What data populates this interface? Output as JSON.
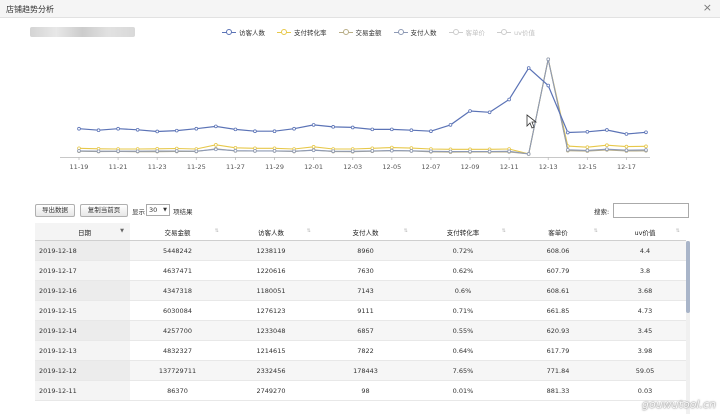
{
  "window": {
    "title": "店铺趋势分析",
    "close_glyph": "×"
  },
  "legend": [
    {
      "name": "访客人数",
      "color": "#5b73b6",
      "active": true
    },
    {
      "name": "支付转化率",
      "color": "#e7c84a",
      "active": true
    },
    {
      "name": "交易金额",
      "color": "#b8ad86",
      "active": true
    },
    {
      "name": "支付人数",
      "color": "#8e9ab5",
      "active": true
    },
    {
      "name": "客单价",
      "color": "#cccccc",
      "active": false
    },
    {
      "name": "uv价值",
      "color": "#cccccc",
      "active": false
    }
  ],
  "chart_data": {
    "type": "line",
    "x_tick_labels": [
      "11-19",
      "11-21",
      "11-23",
      "11-25",
      "11-27",
      "11-29",
      "12-01",
      "12-03",
      "12-05",
      "12-07",
      "12-09",
      "12-11",
      "12-13",
      "12-15",
      "12-17"
    ],
    "x": [
      "11-19",
      "11-20",
      "11-21",
      "11-22",
      "11-23",
      "11-24",
      "11-25",
      "11-26",
      "11-27",
      "11-28",
      "11-29",
      "11-30",
      "12-01",
      "12-02",
      "12-03",
      "12-04",
      "12-05",
      "12-06",
      "12-07",
      "12-08",
      "12-09",
      "12-10",
      "12-11",
      "12-12",
      "12-13",
      "12-14",
      "12-15",
      "12-16",
      "12-17",
      "12-18"
    ],
    "series": [
      {
        "name": "访客人数",
        "color": "#5b73b6",
        "values": [
          1306000,
          1270000,
          1306000,
          1280000,
          1240000,
          1260000,
          1306000,
          1360000,
          1290000,
          1246000,
          1246000,
          1306000,
          1396000,
          1350000,
          1336000,
          1290000,
          1290000,
          1270000,
          1246000,
          1396000,
          1726000,
          1696000,
          2000000,
          2749270,
          2332456,
          1214615,
          1233048,
          1276123,
          1180051,
          1220616,
          1238119
        ]
      },
      {
        "name": "支付转化率",
        "color": "#e7c84a",
        "values": [
          0.46,
          0.42,
          0.4,
          0.4,
          0.42,
          0.44,
          0.4,
          0.74,
          0.5,
          0.46,
          0.46,
          0.4,
          0.58,
          0.4,
          0.4,
          0.46,
          0.52,
          0.48,
          0.4,
          0.38,
          0.38,
          0.38,
          0.4,
          0.01,
          7.65,
          0.64,
          0.55,
          0.71,
          0.6,
          0.62,
          0.72
        ]
      },
      {
        "name": "交易金额",
        "color": "#b8ad86",
        "values": [
          4000000,
          3500000,
          3600000,
          3400000,
          3400000,
          3700000,
          3600000,
          7600000,
          4500000,
          4300000,
          4300000,
          3600000,
          6000000,
          3500000,
          3300000,
          4000000,
          5000000,
          4300000,
          3200000,
          2800000,
          2900000,
          2900000,
          3000000,
          86370,
          137729711,
          4832327,
          4257700,
          6030084,
          4347318,
          4637471,
          5448242
        ]
      },
      {
        "name": "支付人数",
        "color": "#8e9ab5",
        "values": [
          5800,
          5200,
          5300,
          5200,
          5400,
          5600,
          5200,
          8800,
          6200,
          5800,
          5800,
          5200,
          7000,
          5300,
          5100,
          5800,
          6400,
          6000,
          5000,
          4700,
          4700,
          4800,
          5000,
          98,
          178443,
          7822,
          6857,
          9111,
          7143,
          7630,
          8960
        ]
      }
    ],
    "legend_position": "top-center",
    "grid": false
  },
  "toolbar": {
    "export_label": "导出数据",
    "copy_label": "复制当前页",
    "show_label": "显示",
    "page_size": "30",
    "rows_label": "项结果",
    "search_label": "搜索:",
    "search_value": ""
  },
  "table": {
    "columns": [
      "日期",
      "交易金额",
      "访客人数",
      "支付人数",
      "支付转化率",
      "客单价",
      "uv价值"
    ],
    "rows": [
      [
        "2019-12-18",
        "5448242",
        "1238119",
        "8960",
        "0.72%",
        "608.06",
        "4.4"
      ],
      [
        "2019-12-17",
        "4637471",
        "1220616",
        "7630",
        "0.62%",
        "607.79",
        "3.8"
      ],
      [
        "2019-12-16",
        "4347318",
        "1180051",
        "7143",
        "0.6%",
        "608.61",
        "3.68"
      ],
      [
        "2019-12-15",
        "6030084",
        "1276123",
        "9111",
        "0.71%",
        "661.85",
        "4.73"
      ],
      [
        "2019-12-14",
        "4257700",
        "1233048",
        "6857",
        "0.55%",
        "620.93",
        "3.45"
      ],
      [
        "2019-12-13",
        "4832327",
        "1214615",
        "7822",
        "0.64%",
        "617.79",
        "3.98"
      ],
      [
        "2019-12-12",
        "137729711",
        "2332456",
        "178443",
        "7.65%",
        "771.84",
        "59.05"
      ],
      [
        "2019-12-11",
        "86370",
        "2749270",
        "98",
        "0.01%",
        "881.33",
        "0.03"
      ]
    ]
  },
  "watermark": "gouwutool.cn"
}
